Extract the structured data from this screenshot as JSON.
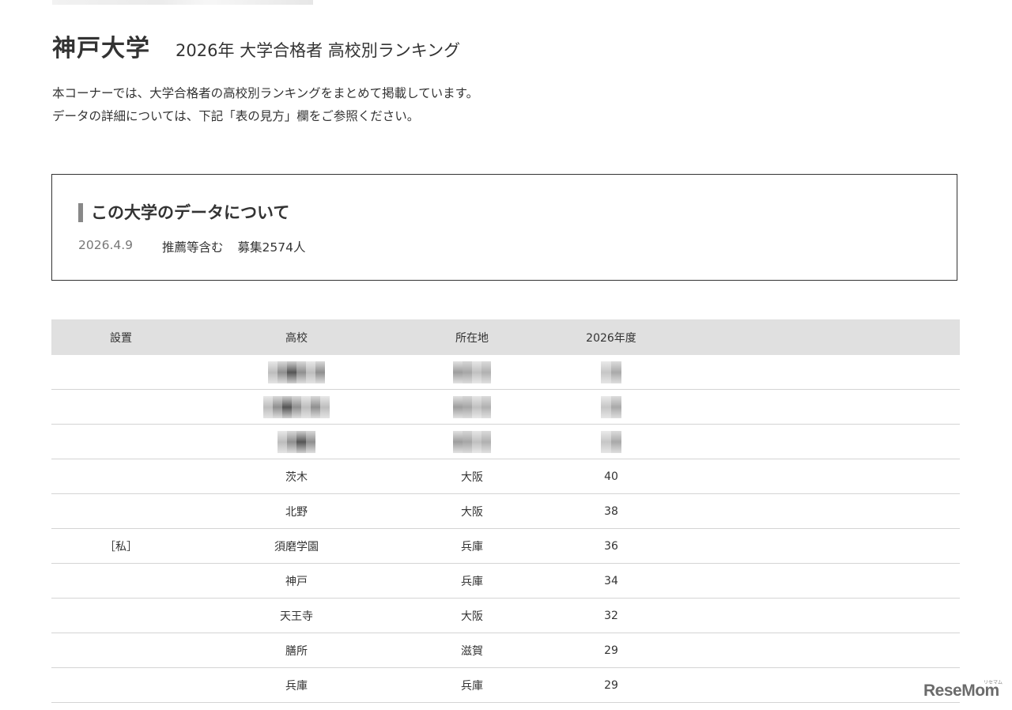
{
  "header": {
    "university": "神戸大学",
    "ranking_title": "2026年 大学合格者 高校別ランキング"
  },
  "intro": {
    "line1": "本コーナーでは、大学合格者の高校別ランキングをまとめて掲載しています。",
    "line2": "データの詳細については、下記「表の見方」欄をご参照ください。"
  },
  "info": {
    "heading": "この大学のデータについて",
    "date": "2026.4.9",
    "condition": "推薦等含む",
    "quota": "募集2574人"
  },
  "table": {
    "headers": [
      "設置",
      "高校",
      "所在地",
      "2026年度"
    ],
    "rows": [
      {
        "type": "",
        "school": "茨木",
        "location": "大阪",
        "count": "40"
      },
      {
        "type": "",
        "school": "北野",
        "location": "大阪",
        "count": "38"
      },
      {
        "type": "［私］",
        "school": "須磨学園",
        "location": "兵庫",
        "count": "36"
      },
      {
        "type": "",
        "school": "神戸",
        "location": "兵庫",
        "count": "34"
      },
      {
        "type": "",
        "school": "天王寺",
        "location": "大阪",
        "count": "32"
      },
      {
        "type": "",
        "school": "膳所",
        "location": "滋賀",
        "count": "29"
      },
      {
        "type": "",
        "school": "兵庫",
        "location": "兵庫",
        "count": "29"
      }
    ]
  },
  "watermark": {
    "logo": "ReseMom",
    "logo_reading": "リセマム"
  }
}
